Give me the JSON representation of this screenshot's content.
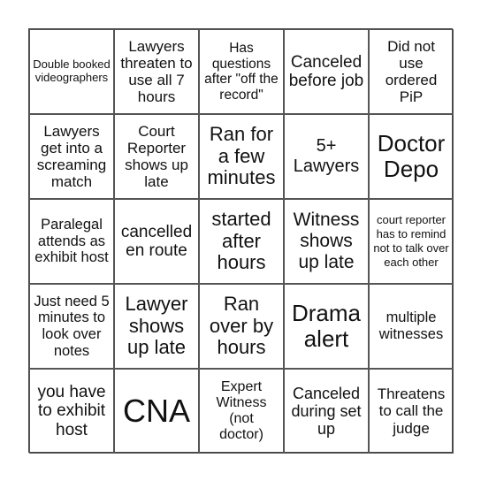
{
  "board": {
    "cells": [
      "Double booked videographers",
      "Lawyers threaten to use all 7 hours",
      "Has questions after \"off the record\"",
      "Canceled before job",
      "Did not use ordered PiP",
      "Lawyers get into a screaming match",
      "Court Reporter shows up late",
      "Ran for a few minutes",
      "5+ Lawyers",
      "Doctor Depo",
      "Paralegal attends as exhibit host",
      "cancelled en route",
      "started after hours",
      "Witness shows up late",
      "court reporter has to remind not to talk over each other",
      "Just need 5 minutes to look over notes",
      "Lawyer shows up late",
      "Ran over by hours",
      "Drama alert",
      "multiple witnesses",
      "you have to exhibit host",
      "CNA",
      "Expert Witness (not doctor)",
      "Canceled during set up",
      "Threatens to call the judge"
    ]
  }
}
